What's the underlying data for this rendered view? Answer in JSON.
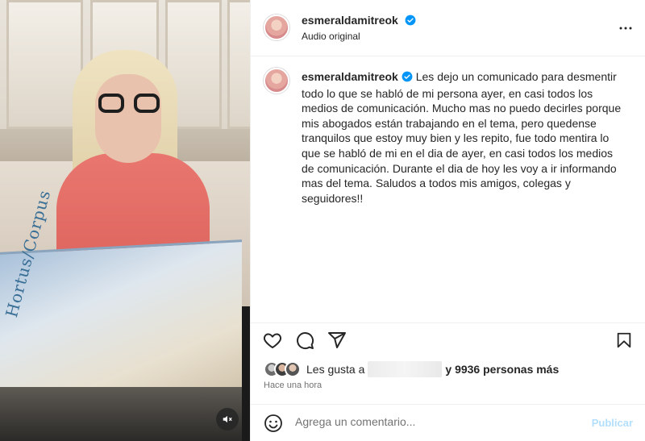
{
  "post": {
    "username": "esmeraldamitreok",
    "audio_label": "Audio original",
    "caption": "Les dejo un comunicado para desmentir todo lo que se habló de mi persona ayer, en casi todos los medios de comunicación. Mucho mas no puedo decirles porque mis abogados están trabajando en el tema, pero quedense tranquilos que estoy muy bien y les repito, fue todo mentira lo que se habló de mi en el dia de ayer, en casi todos los medios de comunicación. Durante el dia de hoy les voy a ir informando mas del tema. Saludos a todos mis amigos, colegas y seguidores!!",
    "book_title": "Hortus/Corpus",
    "likes_prefix": "Les gusta a",
    "likes_suffix": "y 9936 personas más",
    "time_ago": "Hace una hora"
  },
  "comment": {
    "placeholder": "Agrega un comentario...",
    "publish_label": "Publicar"
  },
  "colors": {
    "verified": "#0095f6",
    "publish_disabled": "#b2dffc"
  }
}
